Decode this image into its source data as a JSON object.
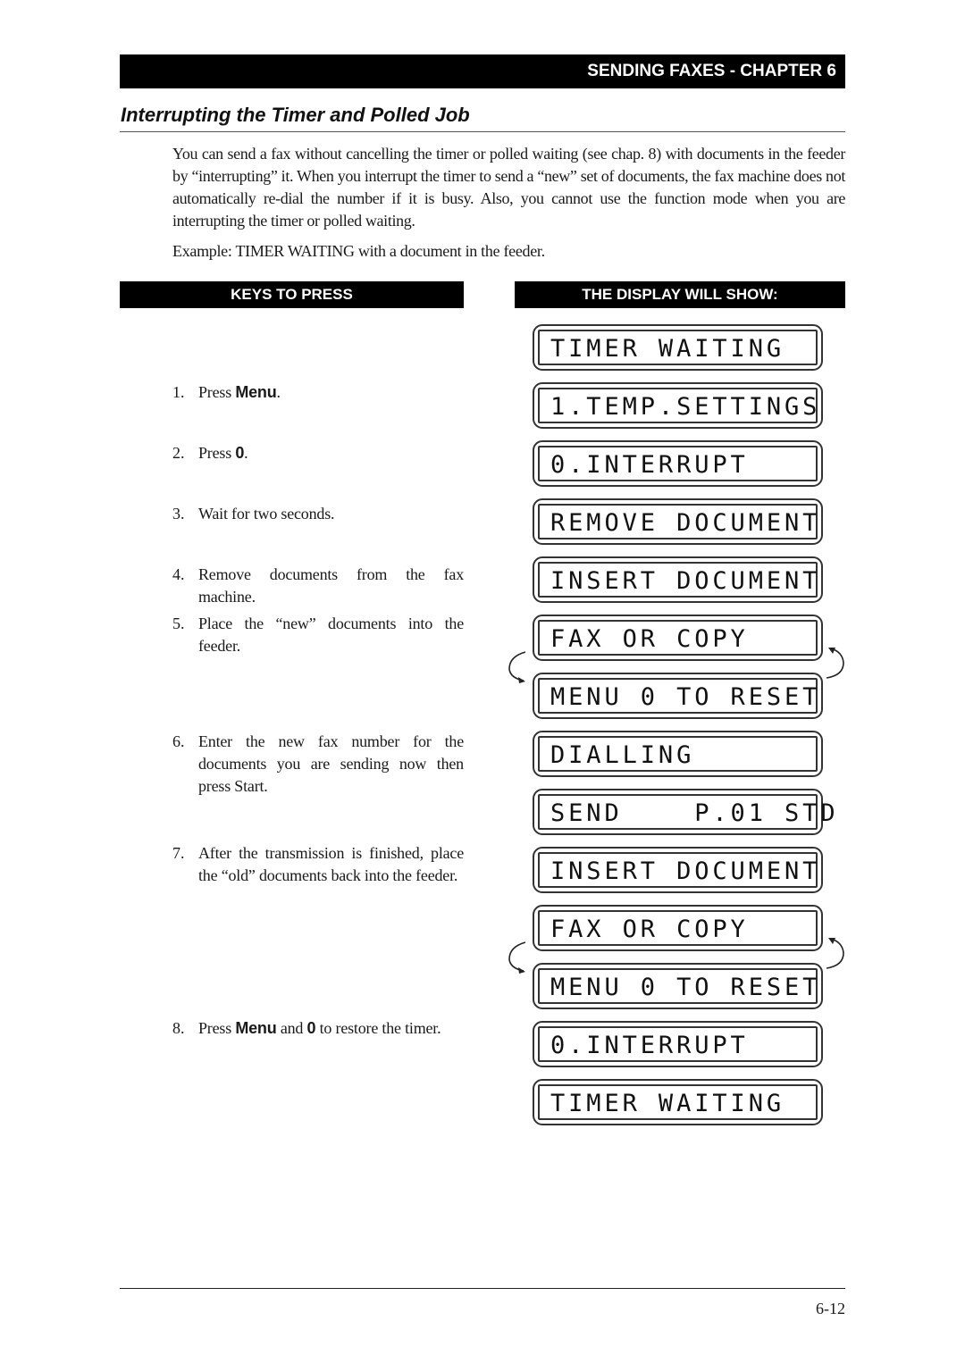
{
  "header": {
    "chapter": "SENDING FAXES - CHAPTER 6"
  },
  "section": {
    "title": "Interrupting the Timer and Polled Job",
    "intro": "You can send a fax without cancelling the timer or polled waiting (see chap. 8) with documents in the feeder by “interrupting” it. When you interrupt the timer to send a “new” set of documents, the fax machine does not automatically re-dial the number if it is busy. Also, you cannot use the function mode when you are interrupting the timer or polled waiting.",
    "example": "Example: TIMER WAITING with a document in the feeder."
  },
  "columns": {
    "keys": "KEYS TO PRESS",
    "display": "THE DISPLAY WILL SHOW:"
  },
  "steps": [
    {
      "num": "1.",
      "pre": "Press ",
      "key": "Menu",
      "post": "."
    },
    {
      "num": "2.",
      "pre": "Press ",
      "key": "0",
      "post": "."
    },
    {
      "num": "3.",
      "text": "Wait for two seconds."
    },
    {
      "num": "4.",
      "text": "Remove documents from the fax machine."
    },
    {
      "num": "5.",
      "text": "Place the “new” documents into the feeder."
    },
    {
      "num": "6.",
      "text": "Enter the new fax number for the documents you are sending now then press Start."
    },
    {
      "num": "7.",
      "text": "After the transmission is finished, place the “old” documents back into the feeder."
    },
    {
      "num": "8.",
      "pre": "Press ",
      "key": "Menu",
      "mid": " and ",
      "key2": "0",
      "post": " to restore the timer."
    }
  ],
  "displays": [
    "TIMER WAITING",
    "1.TEMP.SETTINGS",
    "0.INTERRUPT",
    "REMOVE DOCUMENT",
    "INSERT DOCUMENT",
    "FAX OR COPY",
    "MENU 0 TO RESET",
    "DIALLING",
    "SEND    P.01 STD",
    "INSERT DOCUMENT",
    "FAX OR COPY",
    "MENU 0 TO RESET",
    "0.INTERRUPT",
    "TIMER WAITING"
  ],
  "footer": {
    "page": "6-12"
  }
}
